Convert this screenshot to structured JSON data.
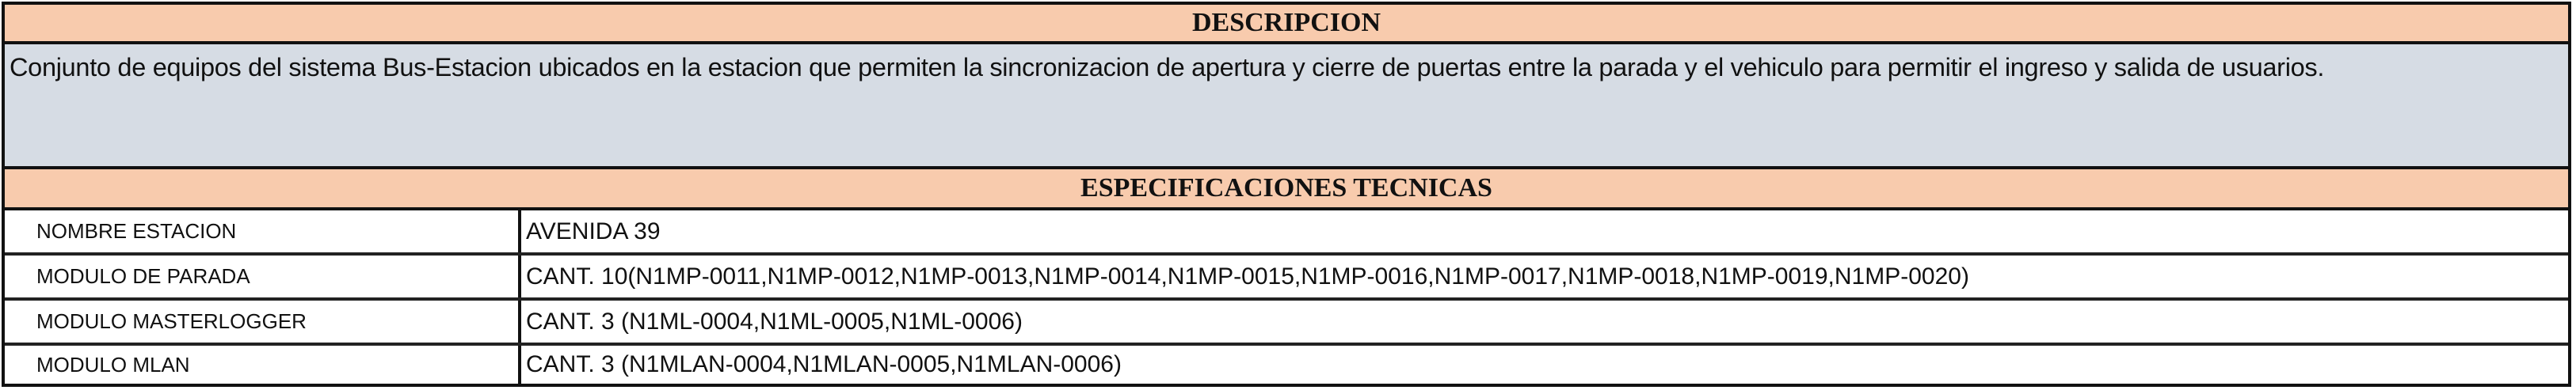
{
  "description_header": "DESCRIPCION",
  "description_text": "Conjunto de equipos del sistema Bus-Estacion ubicados en la estacion que permiten la sincronizacion de apertura y cierre de puertas entre la parada y el vehiculo para permitir el ingreso y salida de usuarios.",
  "specs_header": "ESPECIFICACIONES TECNICAS",
  "specs": [
    {
      "label": "NOMBRE ESTACION",
      "value": "AVENIDA 39"
    },
    {
      "label": "MODULO DE PARADA",
      "value": "CANT. 10(N1MP-0011,N1MP-0012,N1MP-0013,N1MP-0014,N1MP-0015,N1MP-0016,N1MP-0017,N1MP-0018,N1MP-0019,N1MP-0020)"
    },
    {
      "label": "MODULO MASTERLOGGER",
      "value": "CANT. 3 (N1ML-0004,N1ML-0005,N1ML-0006)"
    },
    {
      "label": "MODULO MLAN",
      "value": "CANT. 3 (N1MLAN-0004,N1MLAN-0005,N1MLAN-0006)"
    }
  ],
  "colors": {
    "header_fill": "#F8CBAD",
    "description_fill": "#D6DCE4"
  }
}
